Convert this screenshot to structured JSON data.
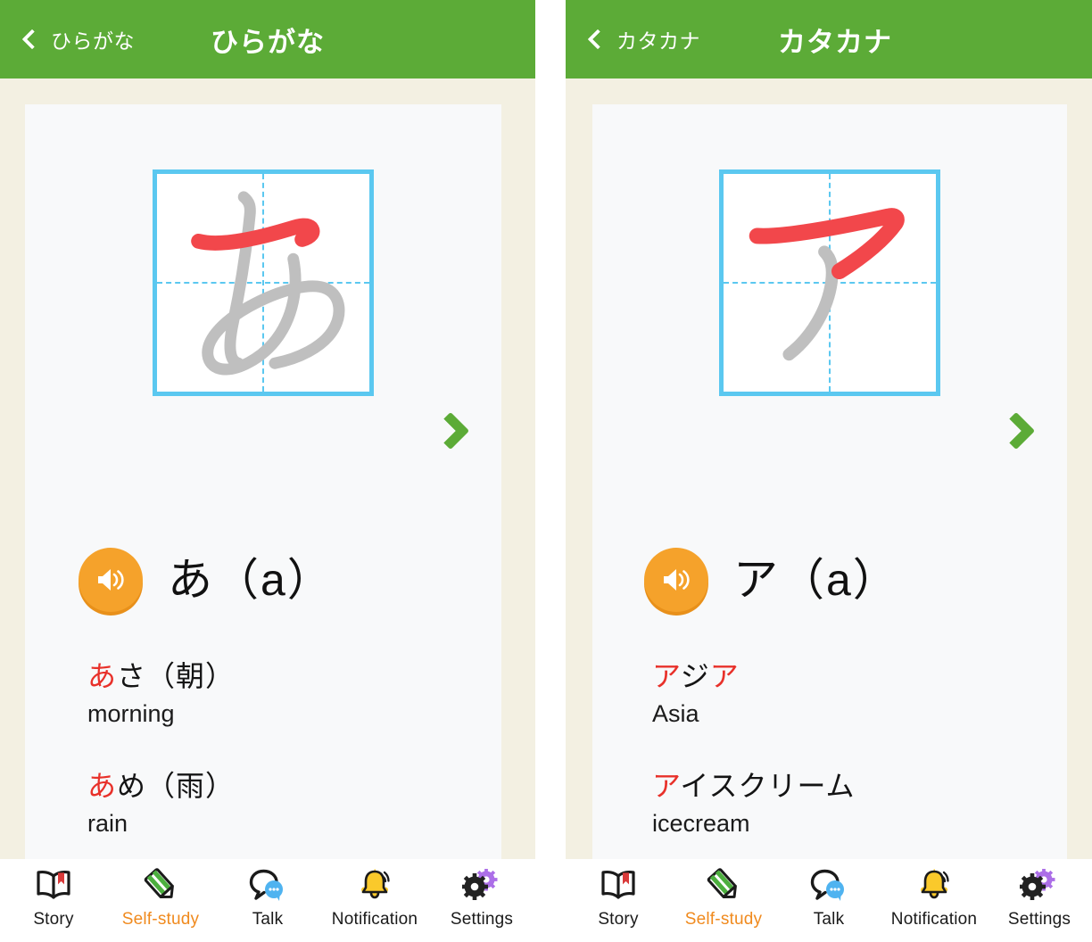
{
  "colors": {
    "header_green": "#5CAB37",
    "page_cream": "#F3F0E2",
    "card_white": "#F8F9FA",
    "grid_blue": "#5BC8F0",
    "stroke_active_red": "#F2474B",
    "stroke_done_gray": "#BFBFBF",
    "speaker_orange": "#F5A22B",
    "vocab_highlight_red": "#E8312A",
    "active_tab_orange": "#F08A1E"
  },
  "screens": [
    {
      "id": "hiragana",
      "header": {
        "back_icon": "chevron-left-icon",
        "back_label": "ひらがな",
        "title": "ひらがな"
      },
      "stroke_card": {
        "character": "あ",
        "grid_icon": "stroke-order-grid",
        "next_icon": "chevron-right-icon"
      },
      "reading": {
        "speaker_icon": "speaker-icon",
        "text": "あ（a）"
      },
      "vocabulary": [
        {
          "jp_highlight": "あ",
          "jp_rest": "さ（朝）",
          "en": "morning"
        },
        {
          "jp_highlight": "あ",
          "jp_rest": "め（雨）",
          "en": "rain"
        }
      ]
    },
    {
      "id": "katakana",
      "header": {
        "back_icon": "chevron-left-icon",
        "back_label": "カタカナ",
        "title": "カタカナ"
      },
      "stroke_card": {
        "character": "ア",
        "grid_icon": "stroke-order-grid",
        "next_icon": "chevron-right-icon"
      },
      "reading": {
        "speaker_icon": "speaker-icon",
        "text": "ア（a）"
      },
      "vocabulary": [
        {
          "jp_highlight": "ア",
          "jp_rest": "ジ",
          "jp_highlight2": "ア",
          "en": "Asia"
        },
        {
          "jp_highlight": "ア",
          "jp_rest": "イスクリーム",
          "en": "icecream"
        }
      ]
    }
  ],
  "tabbar": {
    "items": [
      {
        "label": "Story",
        "icon": "open-book-icon",
        "active": false
      },
      {
        "label": "Self-study",
        "icon": "pencil-icon",
        "active": true
      },
      {
        "label": "Talk",
        "icon": "speech-bubble-icon",
        "active": false
      },
      {
        "label": "Notification",
        "icon": "bell-icon",
        "active": false
      },
      {
        "label": "Settings",
        "icon": "gears-icon",
        "active": false
      }
    ]
  }
}
